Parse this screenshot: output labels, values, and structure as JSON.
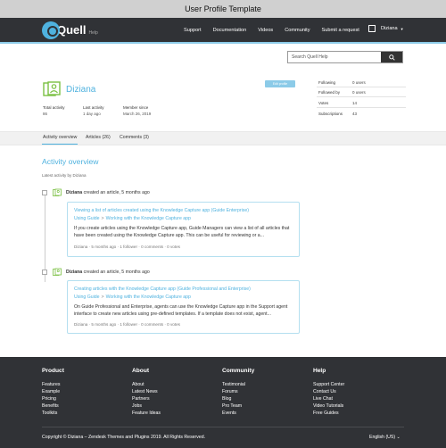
{
  "window": {
    "title": "User Profile Template"
  },
  "header": {
    "logo_text": "Quell",
    "logo_sub": "Help",
    "nav": [
      "Support",
      "Documentation",
      "Videos",
      "Community",
      "Submit a request"
    ],
    "user_name": "Diziana",
    "user_caret": "▼"
  },
  "search": {
    "placeholder": "Search Quell Help"
  },
  "profile": {
    "name": "Diziana",
    "edit_label": "Edit profile",
    "stats": [
      {
        "label": "Total activity",
        "value": "86"
      },
      {
        "label": "Last activity",
        "value": "1 day ago"
      },
      {
        "label": "Member since",
        "value": "March 26, 2019"
      }
    ],
    "side_stats": [
      {
        "label": "Following",
        "value": "0 users"
      },
      {
        "label": "Followed by",
        "value": "0 users"
      },
      {
        "label": "Votes",
        "value": "14"
      },
      {
        "label": "Subscriptions",
        "value": "43"
      }
    ]
  },
  "tabs": [
    "Activity overview",
    "Articles (26)",
    "Comments (3)"
  ],
  "activity": {
    "title": "Activity overview",
    "subtitle": "Latest activity by Diziana",
    "entries": [
      {
        "user": "Diziana",
        "action": " created an article, 5 months ago",
        "title": "Viewing a list of articles created using the Knowledge Capture app (Guide Enterprise)",
        "crumb_parent": "Using Guide",
        "crumb_sep": ">",
        "crumb_child": "Working with the Knowledge Capture app",
        "body": "If you create articles using the Knowledge Capture app, Guide Managers can view a list of all articles that have been created using the Knowledge Capture app. This can be useful for reviewing or a...",
        "meta": "Diziana  ·  5 months ago  ·  1 follower  ·  0 comments  ·  0 votes"
      },
      {
        "user": "Diziana",
        "action": " created an article, 5 months ago",
        "title": "Creating articles with the Knowledge Capture app (Guide Professional and Enterprise)",
        "crumb_parent": "Using Guide",
        "crumb_sep": ">",
        "crumb_child": "Working with the Knowledge Capture app",
        "body": "On Guide Professional and Enterprise, agents can use the Knowledge Capture app in the Support agent interface to create new articles using pre-defined templates. If a template does not exist, agent...",
        "meta": "Diziana  ·  5 months ago  ·  1 follower  ·  0 comments  ·  0 votes"
      }
    ]
  },
  "footer": {
    "columns": [
      {
        "heading": "Product",
        "links": [
          "Features",
          "Example",
          "Pricing",
          "Benefits",
          "Toolkits"
        ]
      },
      {
        "heading": "About",
        "links": [
          "About",
          "Latest News",
          "Partners",
          "Jobs",
          "Feature Ideas"
        ]
      },
      {
        "heading": "Community",
        "links": [
          "Testimonial",
          "Forums",
          "Blog",
          "Pro Team",
          "Events"
        ]
      },
      {
        "heading": "Help",
        "links": [
          "Support Center",
          "Contact Us",
          "Live Chat",
          "Video Tutorials",
          "Free Guides"
        ]
      }
    ],
    "copyright": "Copyright © Diziana – Zendesk Themes and Plugins 2019. All Rights Reserved.",
    "language": "English (US)  ⌄"
  },
  "colors": {
    "accent": "#4fb2df",
    "nav_bg": "#303236",
    "accent_light": "#8ccbe8"
  }
}
